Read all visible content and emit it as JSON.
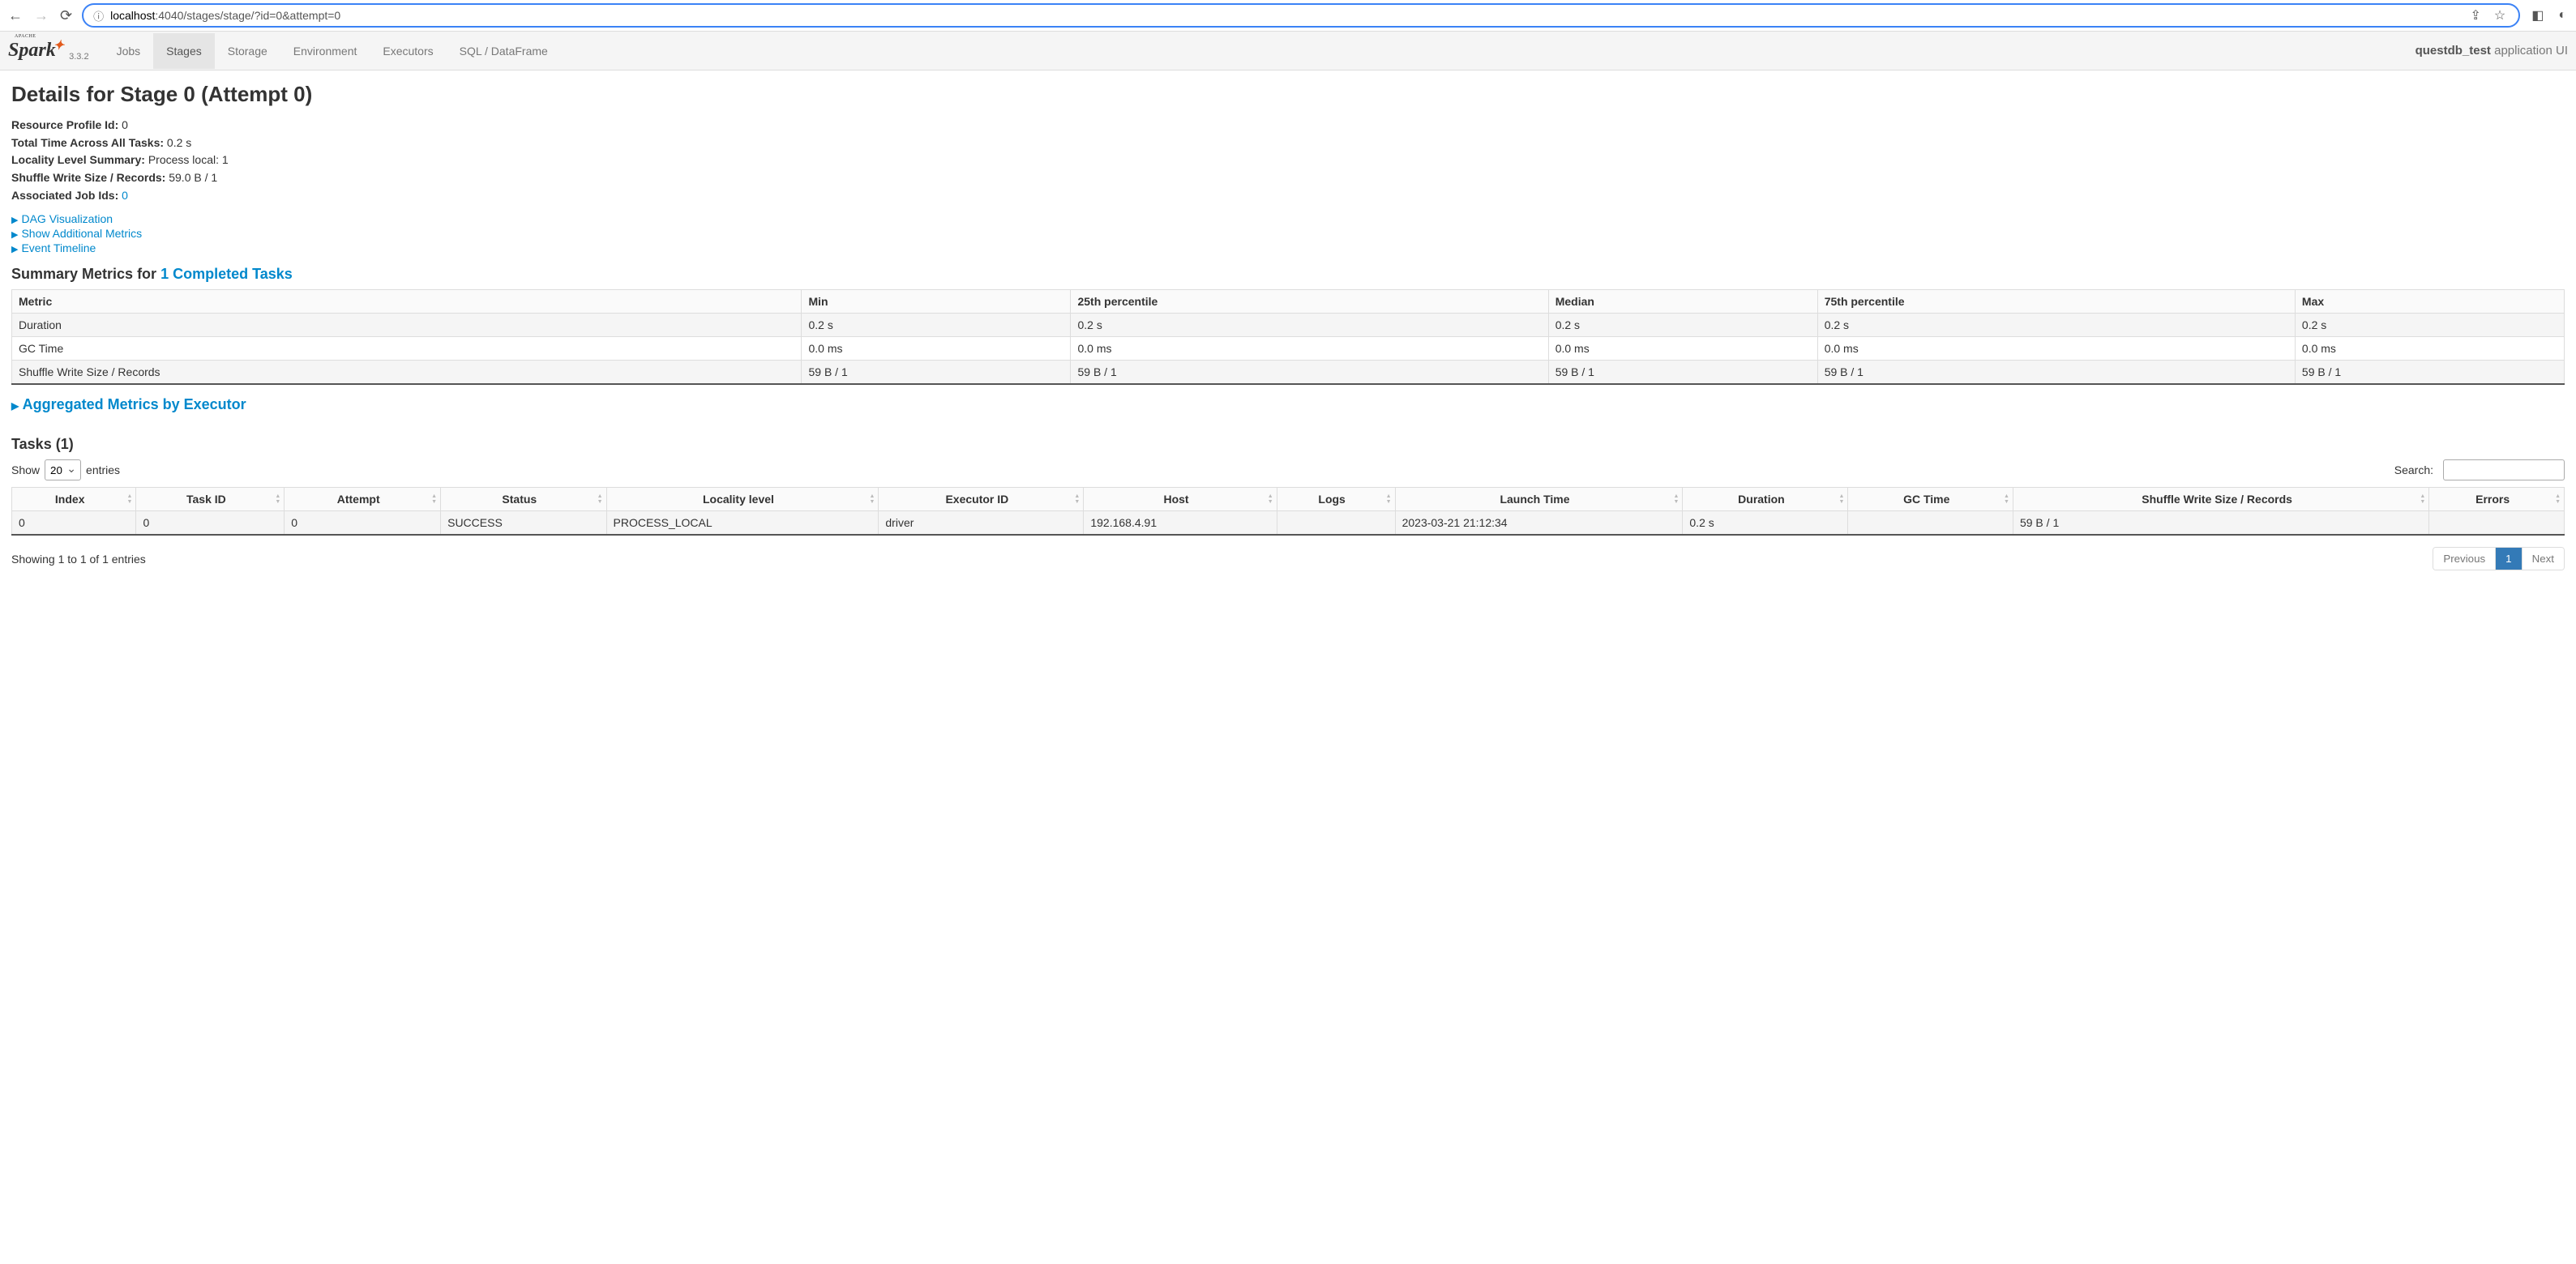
{
  "browser": {
    "url_host": "localhost",
    "url_rest": ":4040/stages/stage/?id=0&attempt=0"
  },
  "header": {
    "version": "3.3.2",
    "app_name": "questdb_test",
    "app_suffix": "application UI",
    "tabs": [
      "Jobs",
      "Stages",
      "Storage",
      "Environment",
      "Executors",
      "SQL / DataFrame"
    ],
    "active_tab": "Stages"
  },
  "page": {
    "title": "Details for Stage 0 (Attempt 0)",
    "facts": {
      "resource_profile_id_label": "Resource Profile Id:",
      "resource_profile_id": "0",
      "total_time_label": "Total Time Across All Tasks:",
      "total_time": "0.2 s",
      "locality_label": "Locality Level Summary:",
      "locality": "Process local: 1",
      "shuffle_write_label": "Shuffle Write Size / Records:",
      "shuffle_write": "59.0 B / 1",
      "job_ids_label": "Associated Job Ids:",
      "job_ids": "0"
    },
    "collapsibles": {
      "dag": "DAG Visualization",
      "additional": "Show Additional Metrics",
      "timeline": "Event Timeline",
      "agg_exec": "Aggregated Metrics by Executor"
    },
    "summary_heading_prefix": "Summary Metrics for ",
    "summary_heading_link": "1 Completed Tasks",
    "summary_table": {
      "headers": [
        "Metric",
        "Min",
        "25th percentile",
        "Median",
        "75th percentile",
        "Max"
      ],
      "rows": [
        [
          "Duration",
          "0.2 s",
          "0.2 s",
          "0.2 s",
          "0.2 s",
          "0.2 s"
        ],
        [
          "GC Time",
          "0.0 ms",
          "0.0 ms",
          "0.0 ms",
          "0.0 ms",
          "0.0 ms"
        ],
        [
          "Shuffle Write Size / Records",
          "59 B / 1",
          "59 B / 1",
          "59 B / 1",
          "59 B / 1",
          "59 B / 1"
        ]
      ]
    },
    "tasks_heading": "Tasks (1)",
    "tasks_controls": {
      "show_label": "Show",
      "page_size": "20",
      "entries_label": "entries",
      "search_label": "Search:"
    },
    "tasks_table": {
      "headers": [
        "Index",
        "Task ID",
        "Attempt",
        "Status",
        "Locality level",
        "Executor ID",
        "Host",
        "Logs",
        "Launch Time",
        "Duration",
        "GC Time",
        "Shuffle Write Size / Records",
        "Errors"
      ],
      "rows": [
        [
          "0",
          "0",
          "0",
          "SUCCESS",
          "PROCESS_LOCAL",
          "driver",
          "192.168.4.91",
          "",
          "2023-03-21 21:12:34",
          "0.2 s",
          "",
          "59 B / 1",
          ""
        ]
      ]
    },
    "footer": {
      "info": "Showing 1 to 1 of 1 entries",
      "prev": "Previous",
      "page": "1",
      "next": "Next"
    }
  }
}
